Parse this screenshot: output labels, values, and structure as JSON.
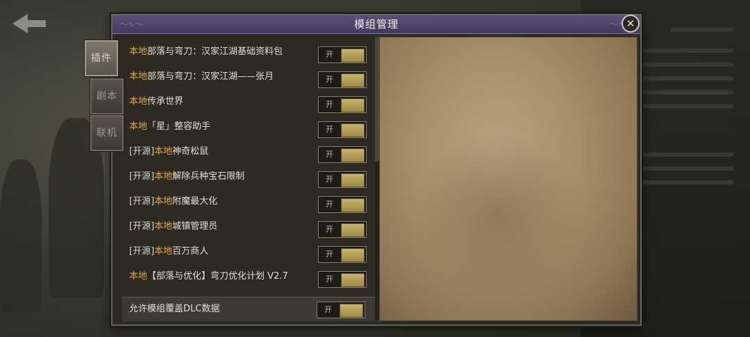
{
  "dialog": {
    "title": "模组管理"
  },
  "tabs": [
    {
      "label": "插件",
      "active": true
    },
    {
      "label": "剧本",
      "active": false
    },
    {
      "label": "联机",
      "active": false
    }
  ],
  "mods": [
    {
      "open_tag": "",
      "local_tag": "本地",
      "name": "部落与弯刀：汉家江湖基础资料包",
      "toggle": "开"
    },
    {
      "open_tag": "",
      "local_tag": "本地",
      "name": "部落与弯刀：汉家江湖——张月",
      "toggle": "开"
    },
    {
      "open_tag": "",
      "local_tag": "本地",
      "name": "传承世界",
      "toggle": "开"
    },
    {
      "open_tag": "",
      "local_tag": "本地",
      "name": "「星」整容助手",
      "toggle": "开"
    },
    {
      "open_tag": "[开源]",
      "local_tag": "本地",
      "name": "神奇松鼠",
      "toggle": "开"
    },
    {
      "open_tag": "[开源]",
      "local_tag": "本地",
      "name": "解除兵种宝石限制",
      "toggle": "开"
    },
    {
      "open_tag": "[开源]",
      "local_tag": "本地",
      "name": "附魔最大化",
      "toggle": "开"
    },
    {
      "open_tag": "[开源]",
      "local_tag": "本地",
      "name": "城镇管理员",
      "toggle": "开"
    },
    {
      "open_tag": "[开源]",
      "local_tag": "本地",
      "name": "百万商人",
      "toggle": "开"
    },
    {
      "open_tag": "",
      "local_tag": "本地",
      "name": "【部落与优化】弯刀优化计划 V2.7",
      "toggle": "开"
    }
  ],
  "footer": {
    "label": "允许模组覆盖DLC数据",
    "toggle": "开"
  },
  "colors": {
    "accent_local": "#e0a84c",
    "title_bar": "#5c5078",
    "toggle_on": "#c8b46a"
  }
}
